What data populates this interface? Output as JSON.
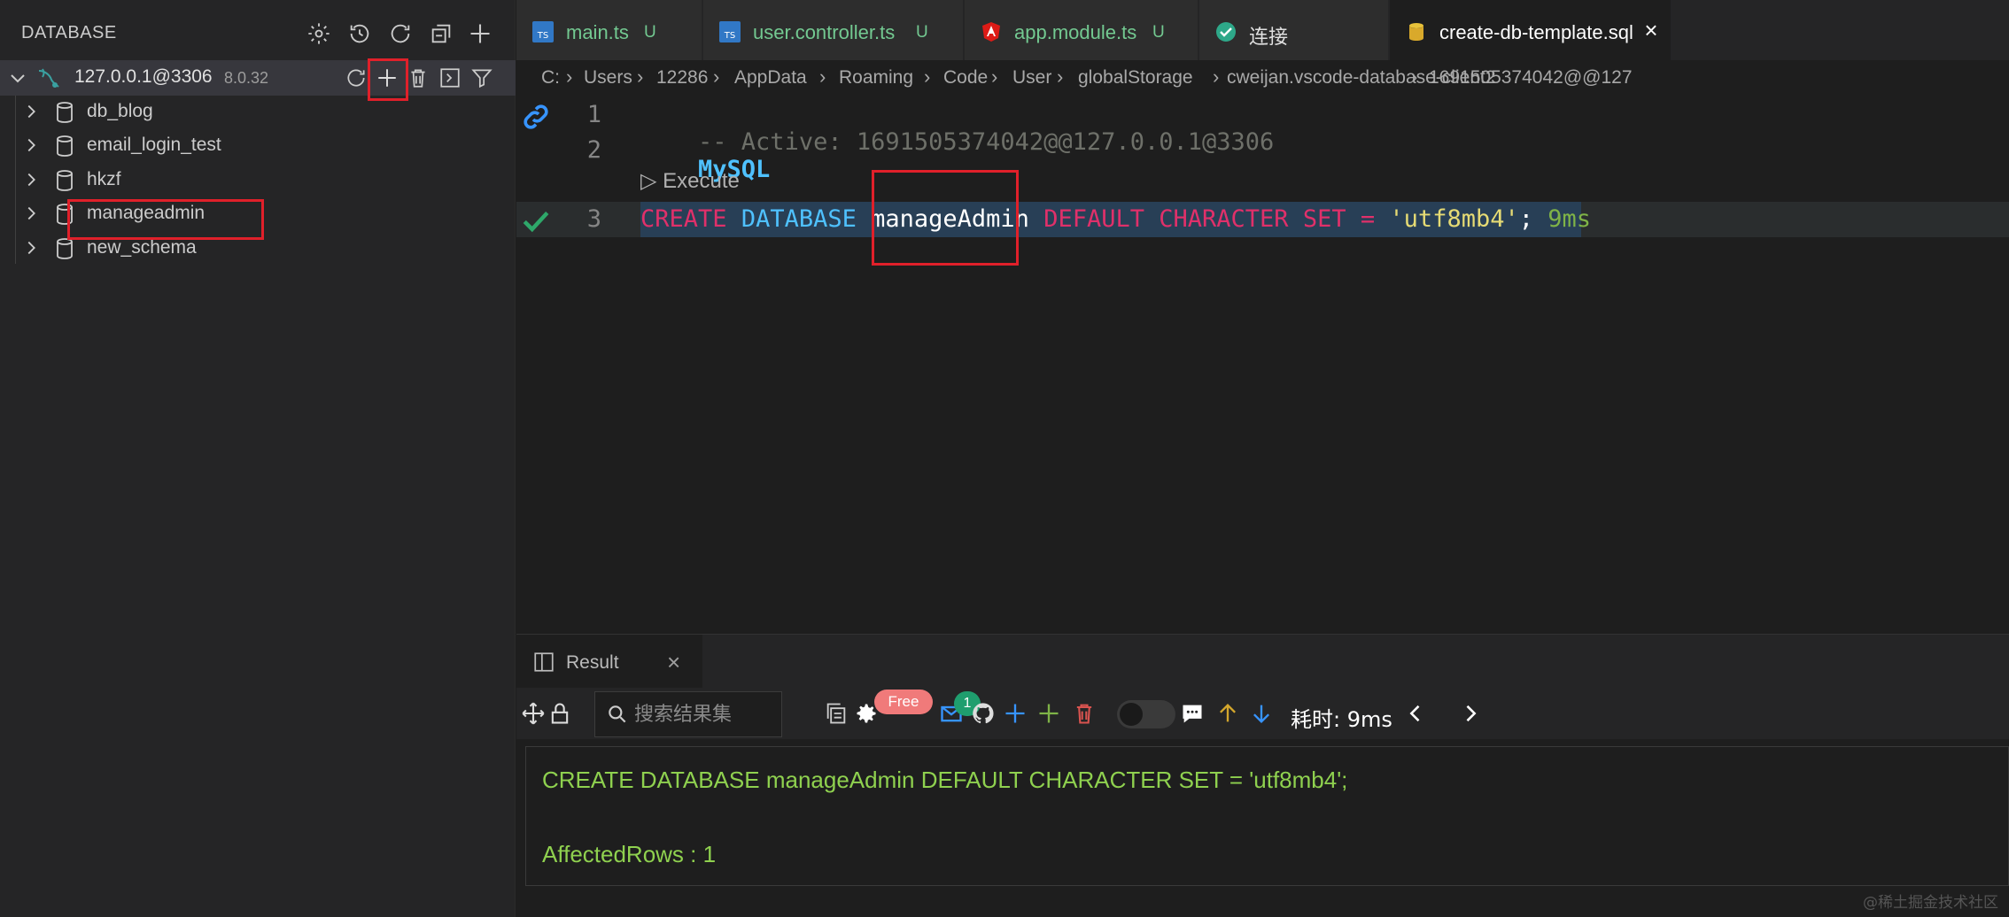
{
  "sidebar": {
    "title": "DATABASE",
    "header_icons": [
      "gear-icon",
      "history-icon",
      "refresh-icon",
      "collapse-all-icon",
      "add-icon"
    ],
    "connection": {
      "name": "127.0.0.1@3306",
      "version": "8.0.32",
      "actions": [
        "refresh-icon",
        "add-icon",
        "delete-icon",
        "terminal-icon",
        "filter-icon"
      ]
    },
    "databases": [
      {
        "label": "db_blog"
      },
      {
        "label": "email_login_test"
      },
      {
        "label": "hkzf"
      },
      {
        "label": "manageadmin"
      },
      {
        "label": "new_schema"
      }
    ]
  },
  "tabs": [
    {
      "label": "main.ts",
      "badge": "U",
      "icon": "typescript-icon"
    },
    {
      "label": "user.controller.ts",
      "badge": "U",
      "icon": "typescript-icon"
    },
    {
      "label": "app.module.ts",
      "badge": "U",
      "icon": "angular-icon"
    },
    {
      "label": "连接",
      "badge": "",
      "icon": "check-circle-icon"
    },
    {
      "label": "create-db-template.sql",
      "badge": "",
      "icon": "database-icon",
      "active": true
    }
  ],
  "breadcrumb": [
    "C:",
    "Users",
    "12286",
    "AppData",
    "Roaming",
    "Code",
    "User",
    "globalStorage",
    "cweijan.vscode-database-client2",
    "1691505374042@@127"
  ],
  "editor": {
    "line_numbers": [
      "1",
      "2",
      "3"
    ],
    "line1_comment": "-- Active: 1691505374042@@127.0.0.1@3306",
    "line1_dialect": "MySQL",
    "codelens": "Execute",
    "line3": {
      "kw1": "CREATE",
      "kw2": "DATABASE",
      "name": "manageAdmin",
      "kw3": "DEFAULT",
      "kw4": "CHARACTER",
      "kw5": "SET",
      "op": "=",
      "str": "'utf8mb4'",
      "semi": ";",
      "time": "9ms"
    }
  },
  "panel": {
    "tab_label": "Result",
    "search_placeholder": "搜索结果集",
    "free_badge": "Free",
    "notification_count": "1",
    "elapsed": "耗时: 9ms",
    "result_sql": "CREATE DATABASE manageAdmin DEFAULT CHARACTER SET = 'utf8mb4';",
    "result_affected": "AffectedRows : 1"
  },
  "watermark": "@稀土掘金技术社区",
  "colors": {
    "keyword": "#e0306a",
    "keyword_blue": "#4fc1ff",
    "string": "#e6db74",
    "result_text": "#8fd14f",
    "highlight_box": "#e0202a"
  }
}
